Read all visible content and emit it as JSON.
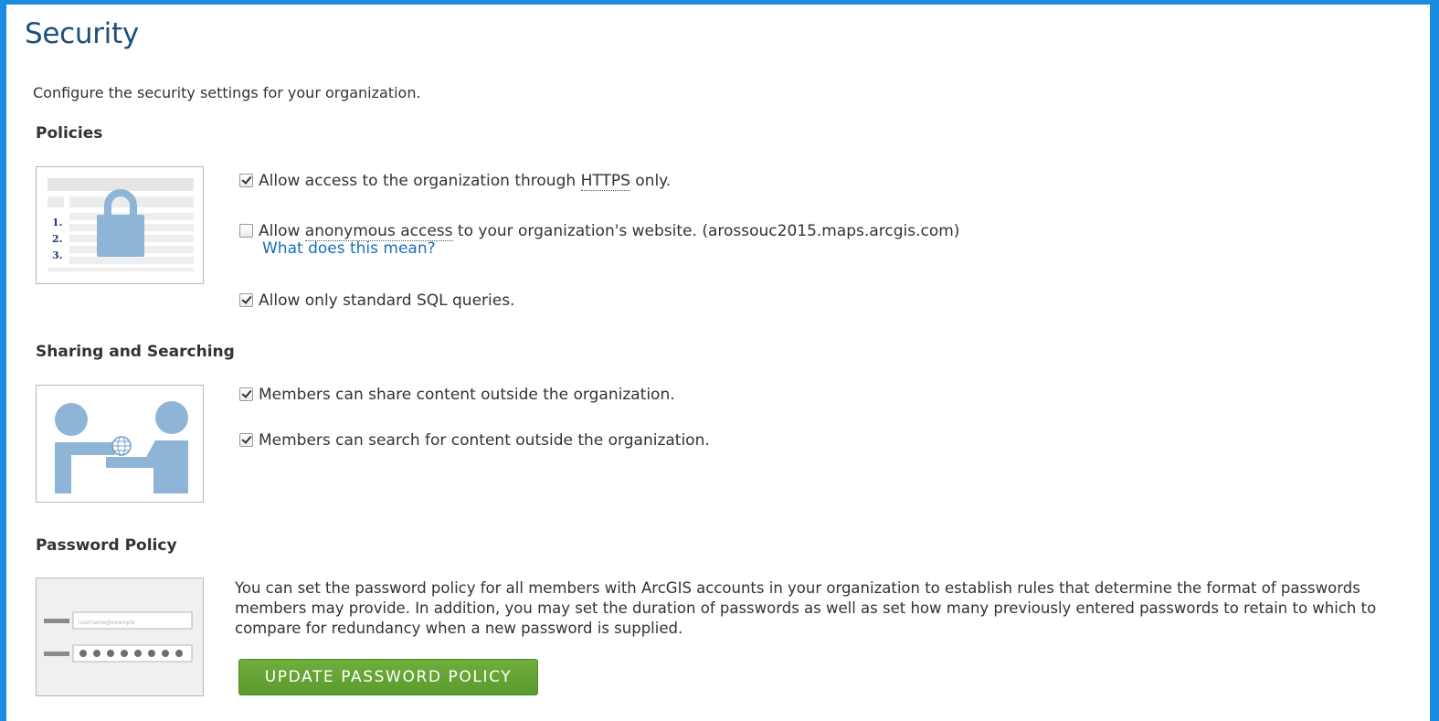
{
  "page": {
    "title": "Security",
    "intro": "Configure the security settings for your organization."
  },
  "policies": {
    "heading": "Policies",
    "https_option": {
      "checked": true,
      "text_before": "Allow access to the organization through",
      "abbr": "HTTPS",
      "text_after": "only."
    },
    "anonymous_option": {
      "checked": false,
      "text_before": "Allow",
      "abbr": "anonymous access",
      "text_after": "to your organization's website. (arossouc2015.maps.arcgis.com)",
      "help_link": "What does this mean?"
    },
    "sql_option": {
      "checked": true,
      "label": "Allow only standard SQL queries."
    },
    "image_list_numbers": [
      "1.",
      "2.",
      "3."
    ]
  },
  "sharing": {
    "heading": "Sharing and Searching",
    "share_option": {
      "checked": true,
      "label": "Members can share content outside the organization."
    },
    "search_option": {
      "checked": true,
      "label": "Members can search for content outside the organization."
    }
  },
  "password": {
    "heading": "Password Policy",
    "description": "You can set the password policy for all members with ArcGIS accounts in your organization to establish rules that determine the format of passwords members may provide. In addition, you may set the duration of passwords as well as set how many previously entered passwords to retain to which to compare for redundancy when a new password is supplied.",
    "button_label": "UPDATE PASSWORD POLICY",
    "image_username_text": "username@example"
  },
  "colors": {
    "background": "#1a8de0",
    "title": "#1f4e79",
    "link": "#1a6fb3",
    "button": "#5b9a2d",
    "illustration": "#8fb5d6"
  }
}
